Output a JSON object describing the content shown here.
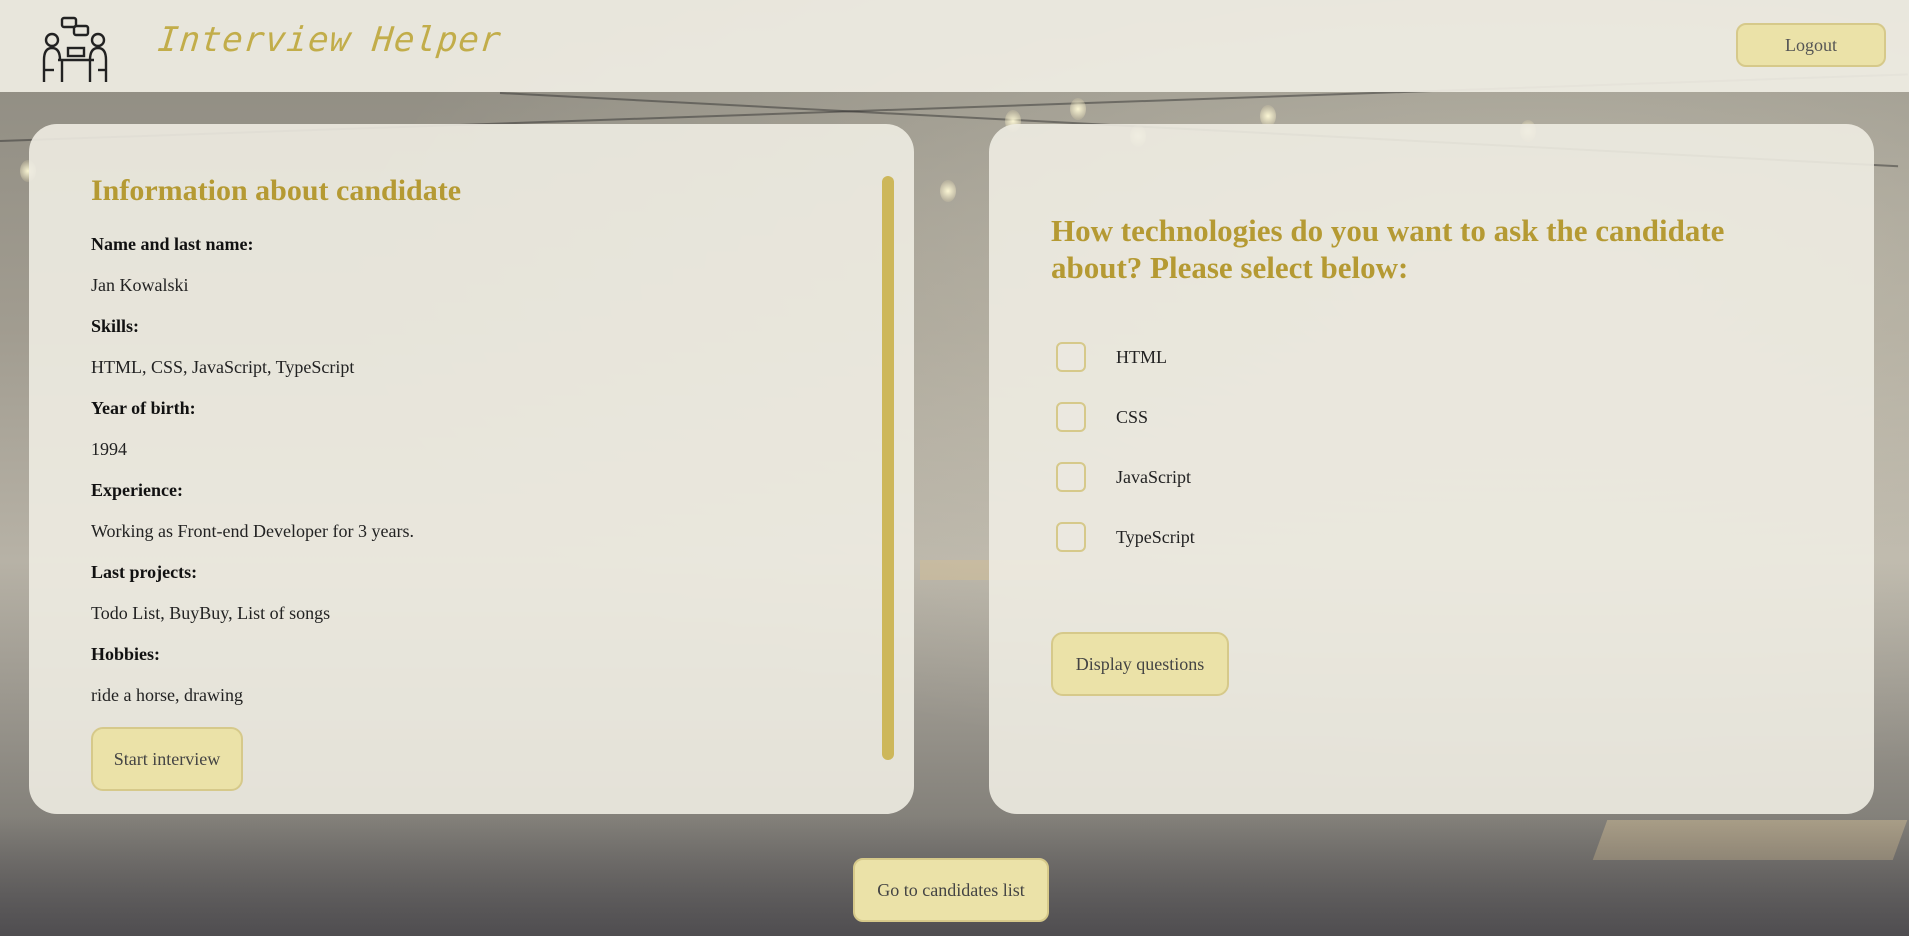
{
  "header": {
    "app_title": "Interview Helper",
    "logo_icon": "interview-people-icon",
    "logout_label": "Logout"
  },
  "candidate": {
    "title": "Information about candidate",
    "fields": [
      {
        "label": "Name and last name:",
        "value": "Jan Kowalski"
      },
      {
        "label": "Skills:",
        "value": "HTML, CSS, JavaScript, TypeScript"
      },
      {
        "label": "Year of birth:",
        "value": "1994"
      },
      {
        "label": "Experience:",
        "value": "Working as Front-end Developer for 3 years."
      },
      {
        "label": "Last projects:",
        "value": "Todo List, BuyBuy, List of songs"
      },
      {
        "label": "Hobbies:",
        "value": "ride a horse, drawing"
      }
    ],
    "start_label": "Start interview"
  },
  "technologies": {
    "title": "How technologies do you want to ask the candidate about? Please select below:",
    "options": [
      {
        "label": "HTML",
        "checked": false
      },
      {
        "label": "CSS",
        "checked": false
      },
      {
        "label": "JavaScript",
        "checked": false
      },
      {
        "label": "TypeScript",
        "checked": false
      }
    ],
    "display_label": "Display questions"
  },
  "footer": {
    "candidates_list_label": "Go to candidates list"
  },
  "colors": {
    "accent": "#b59a33",
    "button_bg": "#ebe2a8",
    "panel_bg": "#eeece2"
  }
}
